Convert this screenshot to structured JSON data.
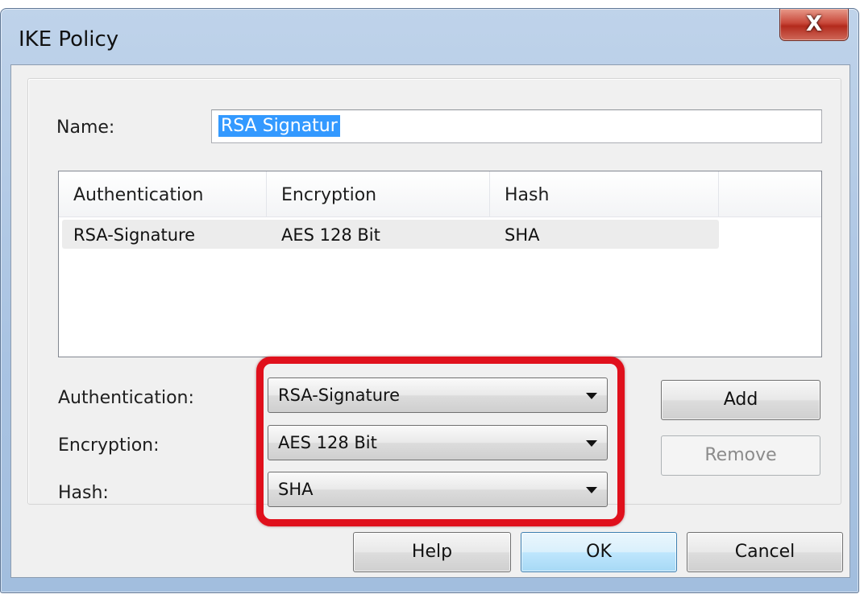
{
  "window": {
    "title": "IKE Policy",
    "close_glyph": "X"
  },
  "name_field": {
    "label": "Name:",
    "value": "RSA Signatur"
  },
  "policy_list": {
    "columns": [
      "Authentication",
      "Encryption",
      "Hash"
    ],
    "rows": [
      {
        "authentication": "RSA-Signature",
        "encryption": "AES 128 Bit",
        "hash": "SHA"
      }
    ]
  },
  "selectors": {
    "authentication": {
      "label": "Authentication:",
      "value": "RSA-Signature"
    },
    "encryption": {
      "label": "Encryption:",
      "value": "AES 128 Bit"
    },
    "hash": {
      "label": "Hash:",
      "value": "SHA"
    }
  },
  "buttons": {
    "add": "Add",
    "remove": "Remove",
    "help": "Help",
    "ok": "OK",
    "cancel": "Cancel"
  },
  "colors": {
    "highlight": "#e0101c",
    "selection": "#3399ff",
    "titlebar": "#a9c3e2"
  }
}
